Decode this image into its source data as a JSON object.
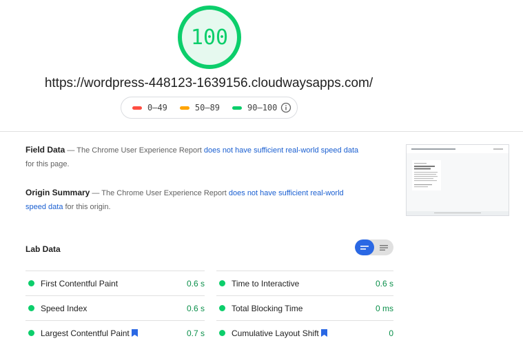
{
  "score": {
    "value": "100",
    "color": "#0cce6b"
  },
  "url": "https://wordpress-448123-1639156.cloudwaysapps.com/",
  "legend": [
    {
      "label": "0–49",
      "color": "#ff4e42"
    },
    {
      "label": "50–89",
      "color": "#ffa400"
    },
    {
      "label": "90–100",
      "color": "#0cce6b"
    }
  ],
  "field_data": {
    "title": "Field Data",
    "prefix": " — The Chrome User Experience Report ",
    "link": "does not have sufficient real-world speed data",
    "suffix": " for this page."
  },
  "origin_summary": {
    "title": "Origin Summary",
    "prefix": " — The Chrome User Experience Report ",
    "link": "does not have sufficient real-world speed data",
    "suffix": " for this origin."
  },
  "lab": {
    "title": "Lab Data",
    "metrics": [
      {
        "label": "First Contentful Paint",
        "value": "0.6 s"
      },
      {
        "label": "Time to Interactive",
        "value": "0.6 s"
      },
      {
        "label": "Speed Index",
        "value": "0.6 s"
      },
      {
        "label": "Total Blocking Time",
        "value": "0 ms"
      },
      {
        "label": "Largest Contentful Paint",
        "value": "0.7 s"
      },
      {
        "label": "Cumulative Layout Shift",
        "value": "0"
      }
    ]
  }
}
